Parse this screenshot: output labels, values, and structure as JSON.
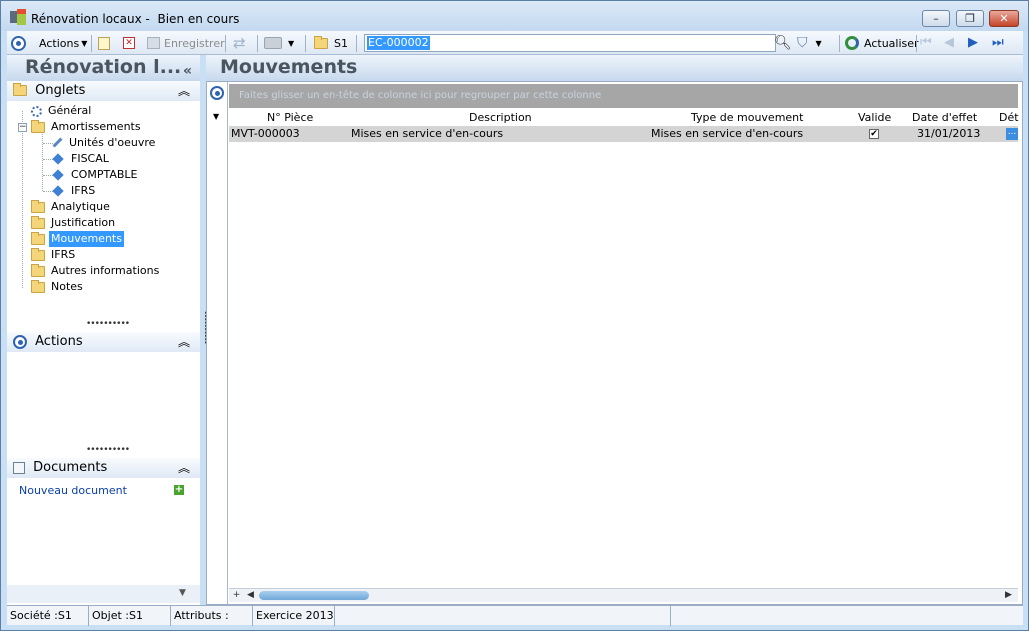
{
  "window": {
    "title": "Rénovation locaux -  Bien en cours",
    "minimize_glyph": "–",
    "maximize_glyph": "❐",
    "close_glyph": "✕"
  },
  "toolbar": {
    "actions_label": "Actions",
    "save_label": "Enregistrer",
    "s1_label": "S1",
    "search_value": "EC-000002",
    "refresh_label": "Actualiser"
  },
  "left": {
    "title": "Rénovation l...",
    "collapse_glyph": "«",
    "tabs_header": "Onglets",
    "tree": [
      {
        "label": "Général"
      },
      {
        "label": "Amortissements"
      },
      {
        "label": "Unités d'oeuvre"
      },
      {
        "label": "FISCAL"
      },
      {
        "label": "COMPTABLE"
      },
      {
        "label": "IFRS"
      },
      {
        "label": "Analytique"
      },
      {
        "label": "Justification"
      },
      {
        "label": "Mouvements"
      },
      {
        "label": "IFRS"
      },
      {
        "label": "Autres informations"
      },
      {
        "label": "Notes"
      }
    ],
    "actions_header": "Actions",
    "documents_header": "Documents",
    "new_document": "Nouveau document"
  },
  "main": {
    "title": "Mouvements",
    "group_hint": "Faites glisser un en-tête de colonne ici pour regrouper par cette colonne",
    "columns": [
      "N° Pièce",
      "Description",
      "Type de mouvement",
      "Valide",
      "Date d'effet",
      "Dét"
    ],
    "rows": [
      {
        "piece": "MVT-000003",
        "description": "Mises en service d'en-cours",
        "type": "Mises en service d'en-cours",
        "valide": "✔",
        "date": "31/01/2013",
        "det": "..."
      }
    ]
  },
  "status": {
    "societe": "Société :S1",
    "objet": "Objet :S1",
    "attributs": "Attributs :",
    "exercice": "Exercice 2013"
  }
}
